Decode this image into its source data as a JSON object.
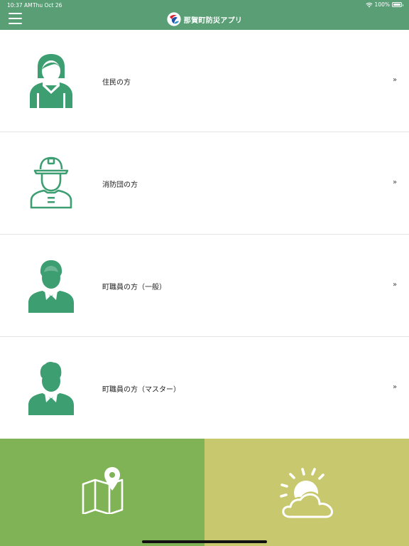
{
  "status_bar": {
    "time": "10:37 AM",
    "date": "Thu Oct 26",
    "battery_text": "100%"
  },
  "header": {
    "title": "那賀町防災アプリ",
    "icons": [
      "menu-icon",
      "town-logo"
    ]
  },
  "menu": {
    "items": [
      {
        "label": "住民の方",
        "icon": "resident-woman-icon",
        "chevron": "»"
      },
      {
        "label": "消防団の方",
        "icon": "firefighter-icon",
        "chevron": "»"
      },
      {
        "label": "町職員の方（一般）",
        "icon": "staff-man-icon",
        "chevron": "»"
      },
      {
        "label": "町職員の方（マスター）",
        "icon": "staff-master-icon",
        "chevron": "»"
      }
    ]
  },
  "tiles": {
    "map_icon": "map-pin-icon",
    "weather_icon": "sun-cloud-icon"
  },
  "colors": {
    "header": "#5a9e76",
    "icon_green": "#3d9e72",
    "map_tile": "#7fb356",
    "weather_tile": "#c8c86e"
  }
}
